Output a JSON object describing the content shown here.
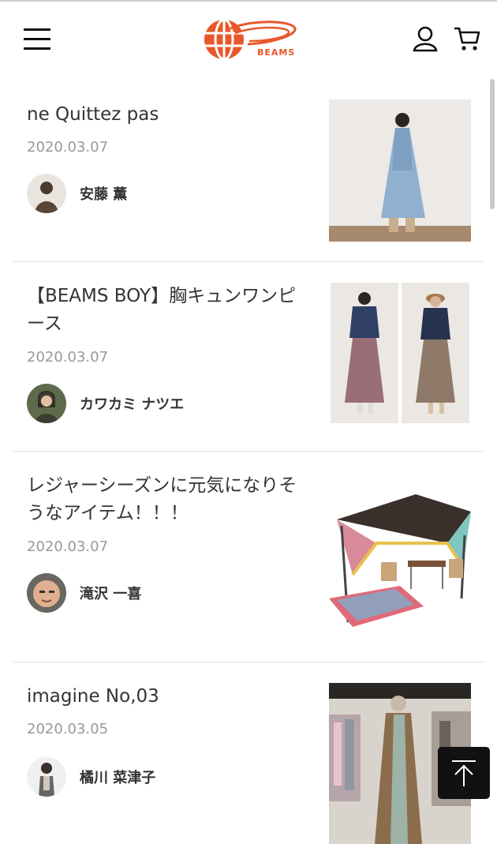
{
  "header": {
    "menu_icon": "hamburger-menu-icon",
    "logo_text": "BEAMS",
    "account_icon": "user-icon",
    "cart_icon": "cart-icon"
  },
  "brand_color": "#e8572a",
  "posts": [
    {
      "title": "ne Quittez pas",
      "date": "2020.03.07",
      "author": "安藤 薫"
    },
    {
      "title": "【BEAMS BOY】胸キュンワンピース",
      "date": "2020.03.07",
      "author": "カワカミ ナツエ"
    },
    {
      "title": "レジャーシーズンに元気になりそうなアイテム！！！",
      "date": "2020.03.07",
      "author": "滝沢 一喜"
    },
    {
      "title": "imagine No,03",
      "date": "2020.03.05",
      "author": "橘川 菜津子"
    }
  ],
  "back_to_top_icon": "arrow-up-icon"
}
